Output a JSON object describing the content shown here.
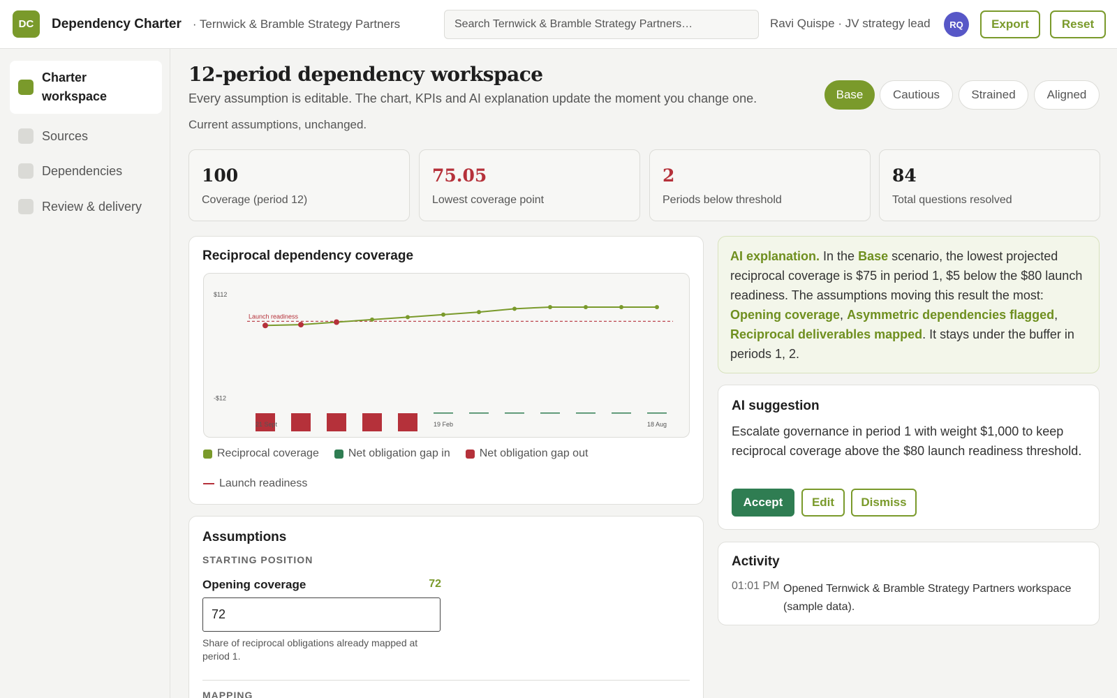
{
  "header": {
    "logo_initials": "DC",
    "app_title": "Dependency Charter",
    "org": "· Ternwick & Bramble Strategy Partners",
    "search_placeholder": "Search Ternwick & Bramble Strategy Partners…",
    "user": "Ravi Quispe · JV strategy lead",
    "avatar_initials": "RQ",
    "export_label": "Export",
    "reset_label": "Reset"
  },
  "sidebar": {
    "items": [
      {
        "label": "Charter workspace",
        "active": true
      },
      {
        "label": "Sources",
        "active": false
      },
      {
        "label": "Dependencies",
        "active": false
      },
      {
        "label": "Review & delivery",
        "active": false
      }
    ]
  },
  "main": {
    "title": "12-period dependency workspace",
    "subtitle": "Every assumption is editable. The chart, KPIs and AI explanation update the moment you change one.",
    "status": "Current assumptions, unchanged.",
    "scenarios": [
      "Base",
      "Cautious",
      "Strained",
      "Aligned"
    ],
    "active_scenario": "Base"
  },
  "kpis": [
    {
      "value": "100",
      "label": "Coverage (period 12)",
      "tone": "normal"
    },
    {
      "value": "75.05",
      "label": "Lowest coverage point",
      "tone": "danger"
    },
    {
      "value": "2",
      "label": "Periods below threshold",
      "tone": "danger"
    },
    {
      "value": "84",
      "label": "Total questions resolved",
      "tone": "normal"
    }
  ],
  "chart": {
    "title": "Reciprocal dependency coverage",
    "threshold_label": "Launch readiness",
    "legend": {
      "coverage": "Reciprocal coverage",
      "gap_in": "Net obligation gap in",
      "gap_out": "Net obligation gap out",
      "threshold": "Launch readiness"
    }
  },
  "chart_data": {
    "type": "line",
    "x": [
      "21 Sept",
      "",
      "",
      "",
      "",
      "19 Feb",
      "",
      "",
      "",
      "",
      "",
      "18 Aug"
    ],
    "x_tick_labels": {
      "0": "21 Sept",
      "5": "19 Feb",
      "11": "18 Aug"
    },
    "y_tick_labels": [
      "$112",
      "-$12"
    ],
    "ylim": [
      -30,
      112
    ],
    "series": [
      {
        "name": "Reciprocal coverage",
        "type": "line",
        "values": [
          75,
          76,
          79,
          82,
          85,
          88,
          91,
          95,
          97,
          97,
          97,
          97
        ]
      },
      {
        "name": "Net obligation gap in",
        "type": "bar",
        "values": [
          0,
          0,
          0,
          0,
          0,
          0.5,
          0.5,
          0.5,
          0.5,
          0.5,
          0.5,
          0.5
        ]
      },
      {
        "name": "Net obligation gap out",
        "type": "bar",
        "values": [
          -5,
          -5,
          -5,
          -5,
          -5,
          0,
          0,
          0,
          0,
          0,
          0,
          0
        ]
      }
    ],
    "threshold": {
      "name": "Launch readiness",
      "value": 80
    },
    "colors": {
      "coverage": "#7a9a2b",
      "gap_in": "#2f7d52",
      "gap_out": "#b5313a",
      "threshold": "#b5313a"
    }
  },
  "assumptions": {
    "title": "Assumptions",
    "section1": "STARTING POSITION",
    "field_label": "Opening coverage",
    "field_value": "72",
    "field_input": "72",
    "field_help": "Share of reciprocal obligations already mapped at period 1.",
    "section2": "MAPPING"
  },
  "ai_explanation": {
    "label": "AI explanation.",
    "t1": " In the ",
    "scenario": "Base",
    "t2": " scenario, the lowest projected reciprocal coverage is $75 in period 1, $5 below the $80 launch readiness. The assumptions moving this result the most: ",
    "d1": "Opening coverage",
    "sep1": ", ",
    "d2": "Asymmetric dependencies flagged",
    "sep2": ", ",
    "d3": "Reciprocal deliverables mapped",
    "t3": ". It stays under the buffer in periods 1, 2."
  },
  "suggestion": {
    "title": "AI suggestion",
    "text": "Escalate governance in period 1 with weight $1,000 to keep reciprocal coverage above the $80 launch readiness threshold.",
    "accept": "Accept",
    "edit": "Edit",
    "dismiss": "Dismiss"
  },
  "activity": {
    "title": "Activity",
    "time": "01:01 PM",
    "text": "Opened Ternwick & Bramble Strategy Partners workspace (sample data)."
  }
}
